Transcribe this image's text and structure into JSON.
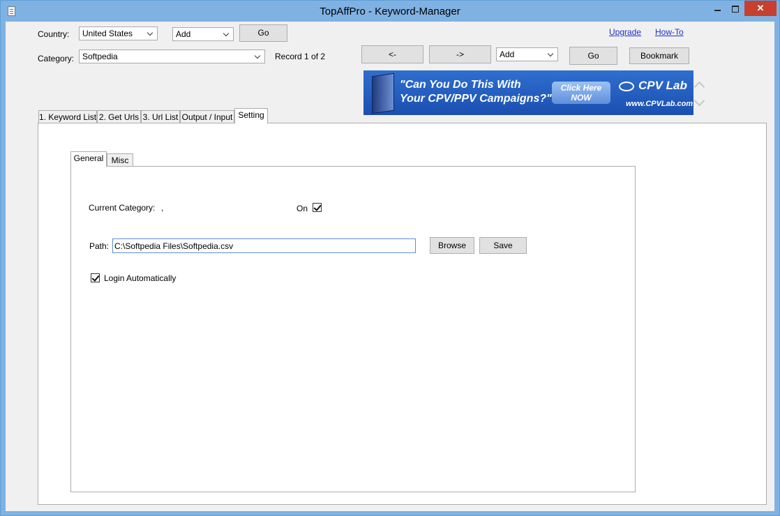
{
  "window": {
    "title": "TopAffPro - Keyword-Manager",
    "minimize": "—",
    "maximize": "☐",
    "close": "✕"
  },
  "top": {
    "country_label": "Country:",
    "country_value": "United States",
    "add_value_1": "Add",
    "go_label_1": "Go",
    "category_label": "Category:",
    "category_value": "Softpedia",
    "record_text": "Record 1 of 2",
    "prev_label": "<-",
    "next_label": "->",
    "add_value_2": "Add",
    "go_label_2": "Go",
    "bookmark_label": "Bookmark",
    "upgrade_link": "Upgrade",
    "howto_link": "How-To"
  },
  "banner": {
    "headline_line1": "\"Can You Do This With",
    "headline_line2": "Your CPV/PPV Campaigns?\"",
    "cta_line1": "Click Here",
    "cta_line2": "NOW",
    "brand": "CPV Lab",
    "site": "www.CPVLab.com"
  },
  "tabs": [
    {
      "label": "1. Keyword List"
    },
    {
      "label": "2. Get Urls"
    },
    {
      "label": "3. Url List"
    },
    {
      "label": "Output / Input"
    },
    {
      "label": "Setting"
    }
  ],
  "subtabs": [
    {
      "label": "General"
    },
    {
      "label": "Misc"
    }
  ],
  "settings": {
    "current_category_label": "Current Category:",
    "current_category_value": ",",
    "on_label": "On",
    "path_label": "Path:",
    "path_value": "C:\\Softpedia Files\\Softpedia.csv",
    "browse_label": "Browse",
    "save_label": "Save",
    "login_label": "Login Automatically"
  }
}
